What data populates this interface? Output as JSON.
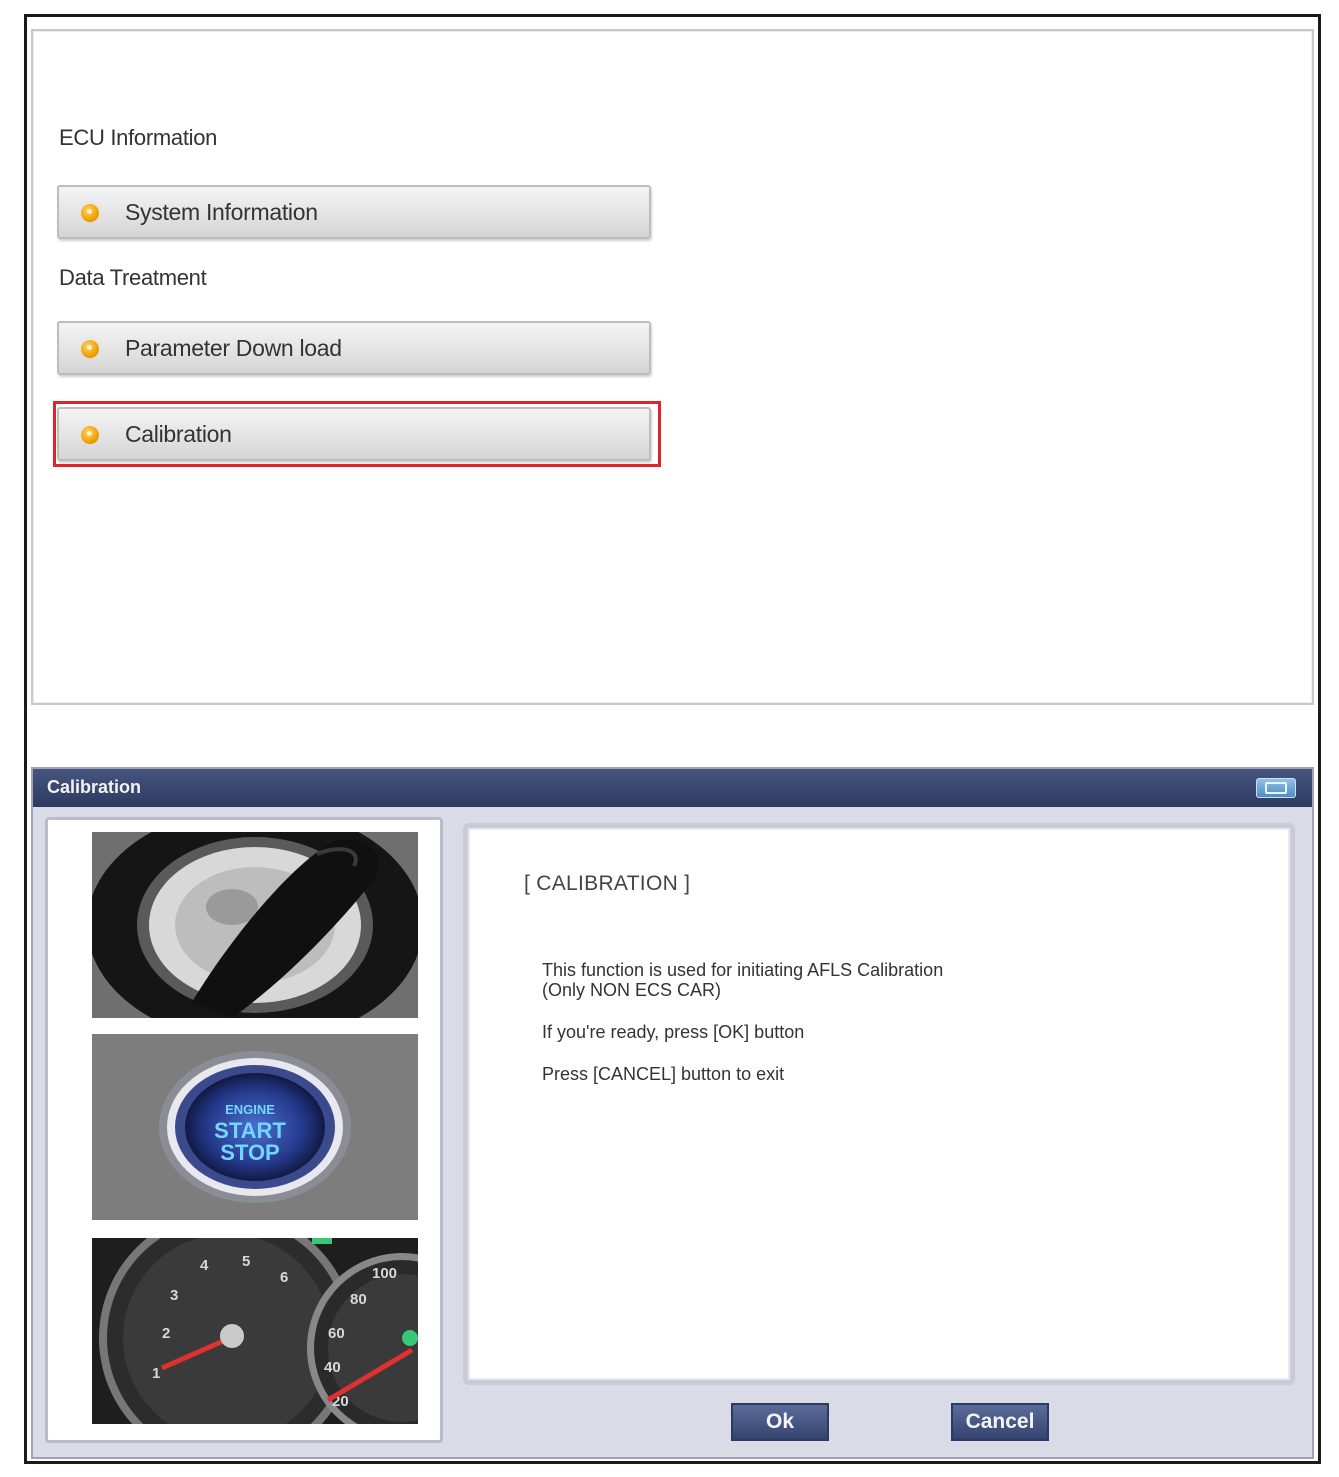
{
  "menu": {
    "ecu_section_label": "ECU Information",
    "system_information_label": "System Information",
    "data_section_label": "Data Treatment",
    "parameter_download_label": "Parameter Down load",
    "calibration_label": "Calibration",
    "highlight_color": "#e0242c",
    "bullet_icon": "orange-circle-bullet-icon"
  },
  "dialog": {
    "title": "Calibration",
    "titlebar_icon": "window-restore-icon",
    "images": [
      "ignition-key-cylinder-photo",
      "engine-start-stop-button-photo",
      "instrument-cluster-gauges-photo"
    ],
    "start_button_text": [
      "ENGINE",
      "START",
      "STOP"
    ],
    "heading": "[ CALIBRATION ]",
    "lines": [
      "This function is used for initiating AFLS Calibration",
      "(Only NON ECS CAR)",
      "If you're ready, press [OK] button",
      "Press [CANCEL] button to exit"
    ],
    "ok_label": "Ok",
    "cancel_label": "Cancel"
  }
}
